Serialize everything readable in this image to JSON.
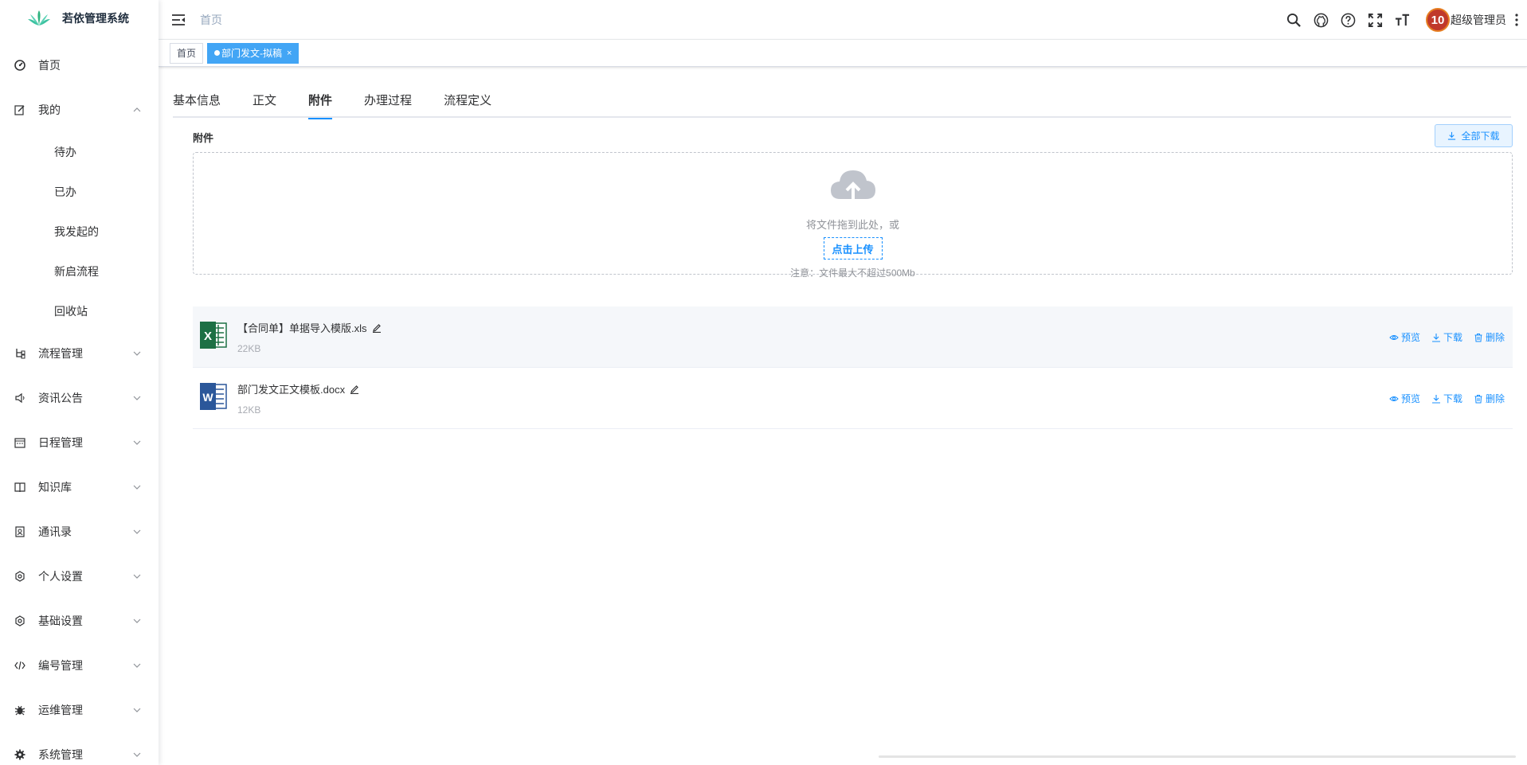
{
  "app": {
    "title": "若依管理系统"
  },
  "sidebar": {
    "items": [
      {
        "label": "首页",
        "icon": "dashboard-icon"
      },
      {
        "label": "我的",
        "icon": "edit-icon",
        "expanded": true,
        "children": [
          "待办",
          "已办",
          "我发起的",
          "新启流程",
          "回收站"
        ]
      },
      {
        "label": "流程管理",
        "icon": "tree-icon"
      },
      {
        "label": "资讯公告",
        "icon": "message-icon"
      },
      {
        "label": "日程管理",
        "icon": "date-icon"
      },
      {
        "label": "知识库",
        "icon": "book-icon"
      },
      {
        "label": "通讯录",
        "icon": "contact-icon"
      },
      {
        "label": "个人设置",
        "icon": "settings-icon"
      },
      {
        "label": "基础设置",
        "icon": "settings-icon"
      },
      {
        "label": "编号管理",
        "icon": "code-icon"
      },
      {
        "label": "运维管理",
        "icon": "bug-icon"
      },
      {
        "label": "系统管理",
        "icon": "system-icon"
      }
    ]
  },
  "header": {
    "breadcrumb": "首页",
    "avatar_text": "10",
    "user_name": "超级管理员",
    "icons": [
      "search-icon",
      "github-icon",
      "question-icon",
      "fullscreen-icon",
      "font-size-icon"
    ]
  },
  "tags": [
    {
      "label": "首页",
      "active": false
    },
    {
      "label": "部门发文-拟稿",
      "active": true,
      "close": "×"
    }
  ],
  "tabs": [
    {
      "label": "基本信息",
      "active": false
    },
    {
      "label": "正文",
      "active": false
    },
    {
      "label": "附件",
      "active": true
    },
    {
      "label": "办理过程",
      "active": false
    },
    {
      "label": "流程定义",
      "active": false
    }
  ],
  "attachments": {
    "title": "附件",
    "download_all": "全部下载",
    "upload": {
      "drop_text": "将文件拖到此处，或",
      "click_text": "点击上传",
      "note": "注意：文件最大不超过500Mb"
    },
    "files": [
      {
        "name": "【合同单】单据导入模版.xls",
        "size": "22KB",
        "type": "excel-file-icon"
      },
      {
        "name": "部门发文正文模板.docx",
        "size": "12KB",
        "type": "word-file-icon"
      }
    ],
    "actions": {
      "preview": "预览",
      "download": "下载",
      "delete": "删除"
    }
  },
  "colors": {
    "primary": "#1890ff",
    "tag_active": "#42a5f5",
    "excel": "#1d7044",
    "word": "#2b579a"
  }
}
